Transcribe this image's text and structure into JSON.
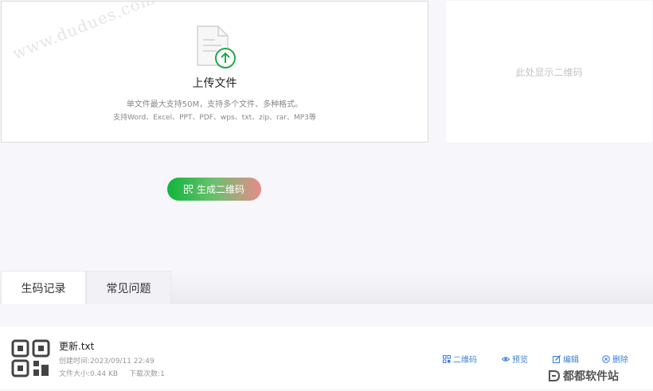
{
  "upload": {
    "watermark": "www.dudues.com",
    "title": "上传文件",
    "description": "单文件最大支持50M，支持多个文件、多种格式。",
    "formats": "支持Word、Excel、PPT、PDF、wps、txt、zip、rar、MP3等",
    "icon": "file-upload-icon"
  },
  "qr_panel": {
    "placeholder": "此处显示二维码"
  },
  "generate_button": {
    "label": "生成二维码",
    "icon": "qr-code-icon"
  },
  "tabs": [
    {
      "label": "生码记录",
      "active": true
    },
    {
      "label": "常见问题",
      "active": false
    }
  ],
  "records": [
    {
      "name": "更新.txt",
      "created_label": "创建时间:",
      "created": "2023/09/11 22:49",
      "size_label": "文件大小:",
      "size": "0.44 KB",
      "downloads_label": "下载次数:",
      "downloads": "1",
      "actions": {
        "qr": "二维码",
        "preview": "预览",
        "edit": "编辑",
        "delete": "删除"
      }
    }
  ],
  "site_logo": {
    "text": "都都软件站"
  },
  "colors": {
    "accent_green": "#11b53c",
    "link_blue": "#3a7fd8",
    "upload_green": "#21a84a"
  }
}
